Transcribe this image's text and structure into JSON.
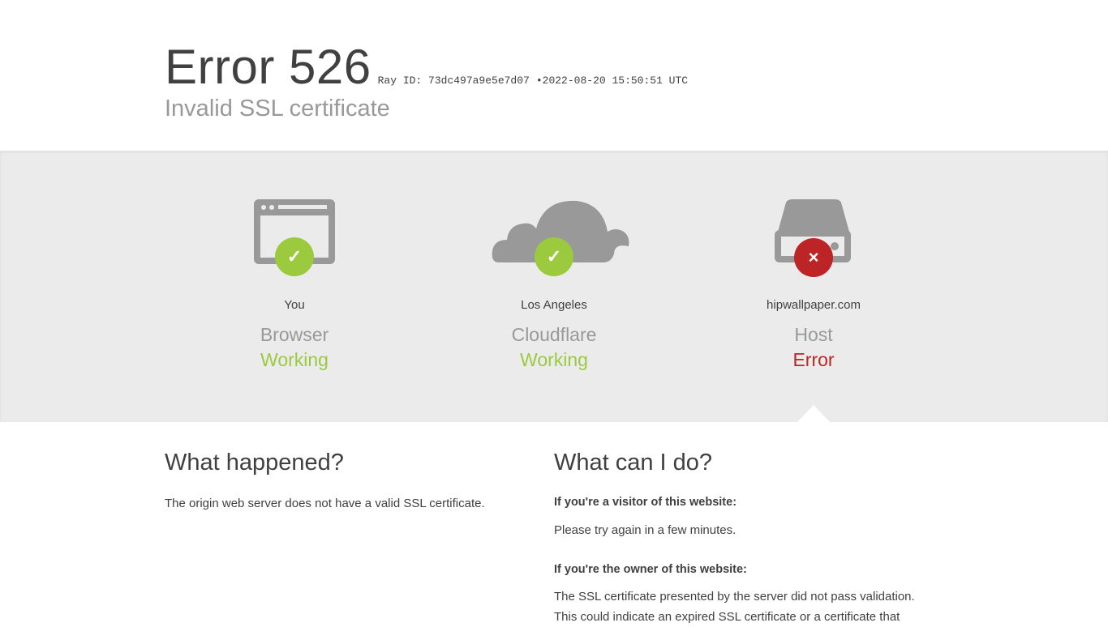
{
  "header": {
    "error_title": "Error 526",
    "ray_id": "Ray ID: 73dc497a9e5e7d07",
    "separator": "•",
    "timestamp": "2022-08-20 15:50:51 UTC",
    "subtitle": "Invalid SSL certificate"
  },
  "nodes": [
    {
      "where": "You",
      "role": "Browser",
      "status": "Working",
      "state": "ok",
      "icon": "browser-icon"
    },
    {
      "where": "Los Angeles",
      "role": "Cloudflare",
      "status": "Working",
      "state": "ok",
      "icon": "cloud-icon"
    },
    {
      "where": "hipwallpaper.com",
      "role": "Host",
      "status": "Error",
      "state": "error",
      "icon": "server-icon"
    }
  ],
  "badges": {
    "ok": "✓",
    "error": "×"
  },
  "colors": {
    "ok": "#9bca3e",
    "error": "#bd2426",
    "icon_gray": "#999999",
    "band_bg": "#ebebeb"
  },
  "what_happened": {
    "heading": "What happened?",
    "text": "The origin web server does not have a valid SSL certificate."
  },
  "what_can_i_do": {
    "heading": "What can I do?",
    "visitor_label": "If you're a visitor of this website:",
    "visitor_text": "Please try again in a few minutes.",
    "owner_label": "If you're the owner of this website:",
    "owner_text_1": "The SSL certificate presented by the server did not pass validation.",
    "owner_text_2": "This could indicate an expired SSL certificate or a certificate that"
  }
}
